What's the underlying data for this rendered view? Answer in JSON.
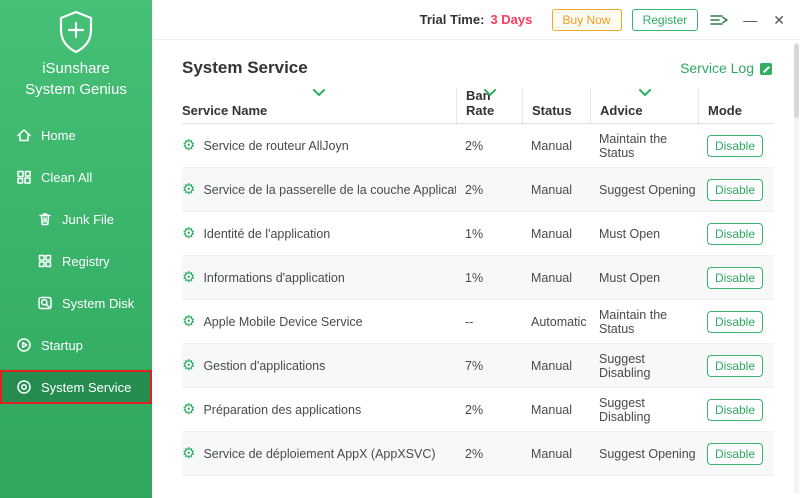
{
  "colors": {
    "accent": "#2fae63",
    "trial_red": "#ff3b5c",
    "buy_orange": "#f5a623",
    "annotation_red": "#e01f1f"
  },
  "app": {
    "name_line1": "iSunshare",
    "name_line2": "System Genius",
    "logo_icon": "shield-plus-logo-icon"
  },
  "topbar": {
    "trial_label": "Trial Time:",
    "trial_value": "3 Days",
    "buy_button": "Buy Now",
    "register_button": "Register",
    "menu_icon": "skin-menu-icon",
    "minimize_glyph": "—",
    "close_glyph": "✕"
  },
  "sidebar": {
    "items": [
      {
        "label": "Home",
        "icon": "home-icon",
        "indent": false,
        "selected": false
      },
      {
        "label": "Clean All",
        "icon": "clean-all-icon",
        "indent": false,
        "selected": false
      },
      {
        "label": "Junk File",
        "icon": "junk-file-icon",
        "indent": true,
        "selected": false
      },
      {
        "label": "Registry",
        "icon": "registry-icon",
        "indent": true,
        "selected": false
      },
      {
        "label": "System Disk",
        "icon": "system-disk-icon",
        "indent": true,
        "selected": false
      },
      {
        "label": "Startup",
        "icon": "startup-icon",
        "indent": false,
        "selected": false
      },
      {
        "label": "System Service",
        "icon": "system-service-icon",
        "indent": false,
        "selected": true
      }
    ]
  },
  "main": {
    "title": "System Service",
    "service_log_label": "Service Log",
    "service_log_icon": "edit-log-icon",
    "row_icon": "gear-icon",
    "sort_icon": "chevron-down-icon"
  },
  "table": {
    "headers": [
      {
        "label": "Service Name",
        "sortable": true
      },
      {
        "label": "Ban Rate",
        "sortable": true
      },
      {
        "label": "Status",
        "sortable": false
      },
      {
        "label": "Advice",
        "sortable": true
      },
      {
        "label": "Mode",
        "sortable": false
      }
    ],
    "rows": [
      {
        "name": "Service de routeur AllJoyn",
        "ban_rate": "2%",
        "status": "Manual",
        "advice": "Maintain the Status",
        "mode": "Disable"
      },
      {
        "name": "Service de la passerelle de la couche Application",
        "ban_rate": "2%",
        "status": "Manual",
        "advice": "Suggest Opening",
        "mode": "Disable"
      },
      {
        "name": "Identité de l'application",
        "ban_rate": "1%",
        "status": "Manual",
        "advice": "Must Open",
        "mode": "Disable"
      },
      {
        "name": "Informations d'application",
        "ban_rate": "1%",
        "status": "Manual",
        "advice": "Must Open",
        "mode": "Disable"
      },
      {
        "name": "Apple Mobile Device Service",
        "ban_rate": "--",
        "status": "Automatic",
        "advice": "Maintain the Status",
        "mode": "Disable"
      },
      {
        "name": "Gestion d'applications",
        "ban_rate": "7%",
        "status": "Manual",
        "advice": "Suggest Disabling",
        "mode": "Disable"
      },
      {
        "name": "Préparation des applications",
        "ban_rate": "2%",
        "status": "Manual",
        "advice": "Suggest Disabling",
        "mode": "Disable"
      },
      {
        "name": "Service de déploiement AppX (AppXSVC)",
        "ban_rate": "2%",
        "status": "Manual",
        "advice": "Suggest Opening",
        "mode": "Disable"
      }
    ]
  }
}
